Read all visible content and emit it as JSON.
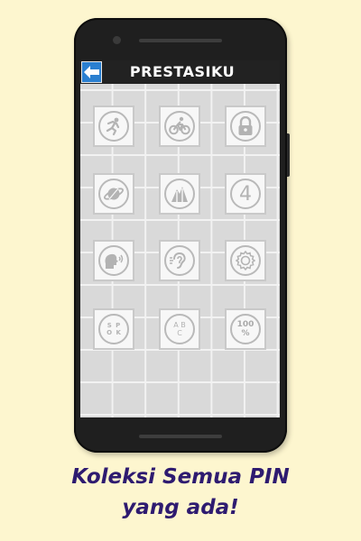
{
  "screen": {
    "title": "PRESTASIKU",
    "back_icon": "left-arrow-icon"
  },
  "pins": [
    {
      "name": "running-figure-pin",
      "icon": "runner-icon"
    },
    {
      "name": "cycling-pin",
      "icon": "bicycle-icon"
    },
    {
      "name": "lock-pin",
      "icon": "padlock-icon"
    },
    {
      "name": "planet-pin",
      "icon": "planet-icon"
    },
    {
      "name": "mountain-pin",
      "icon": "mountain-icon"
    },
    {
      "name": "number-four-pin",
      "icon": "number-four-icon",
      "text": "4"
    },
    {
      "name": "speaking-head-pin",
      "icon": "speaking-head-icon"
    },
    {
      "name": "ear-hearing-pin",
      "icon": "ear-icon"
    },
    {
      "name": "award-badge-pin",
      "icon": "award-badge-icon"
    },
    {
      "name": "letters-pin",
      "icon": "letter-tiles-icon",
      "text": "S P O K"
    },
    {
      "name": "abc-pin",
      "icon": "abc-molecule-icon",
      "text": "A B C"
    },
    {
      "name": "hundred-percent-pin",
      "icon": "hundred-percent-icon",
      "text": "100 %"
    }
  ],
  "caption": {
    "line1": "Koleksi Semua PIN",
    "line2": "yang ada!"
  },
  "colors": {
    "background": "#fdf6cf",
    "titlebar": "#222222",
    "back_button": "#2a7fd0",
    "caption_text": "#2e1b70"
  }
}
